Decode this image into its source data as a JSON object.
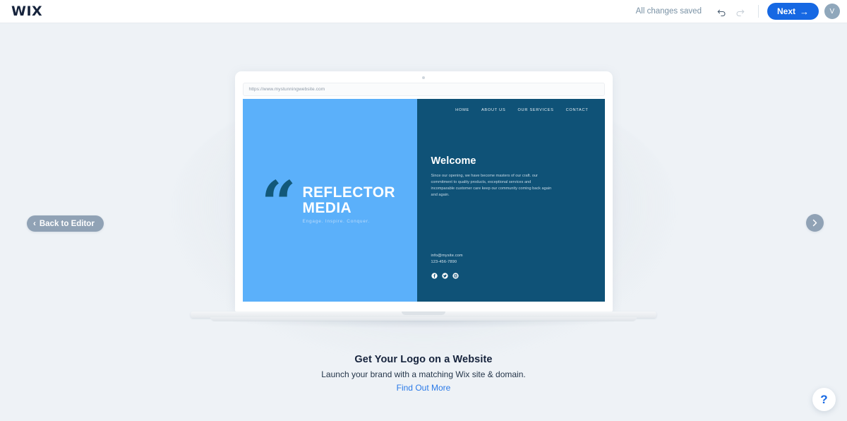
{
  "header": {
    "logo": "WIX",
    "status_text": "All changes saved",
    "undo_icon": "undo-arrow-icon",
    "redo_icon": "redo-arrow-icon",
    "next_label": "Next",
    "next_arrow": "→",
    "avatar_initial": "V",
    "accent_color": "#1668e3",
    "avatar_color": "#8fa7bb"
  },
  "controls": {
    "back_label": "Back to Editor",
    "back_chevron": "‹",
    "next_chevron": "›",
    "help_label": "?",
    "control_color": "#90a2b5"
  },
  "preview": {
    "browser_url": "https://www.mystunningwebsite.com",
    "site": {
      "left_bg": "#5bb0fa",
      "right_bg": "#0f5277",
      "quote_glyph": "“",
      "logo_name_line1": "REFLECTOR",
      "logo_name_line2": "MEDIA",
      "logo_tagline": "Engage. Inspire. Conquer.",
      "nav": [
        {
          "label": "HOME"
        },
        {
          "label": "ABOUT US"
        },
        {
          "label": "OUR SERVICES"
        },
        {
          "label": "CONTACT"
        }
      ],
      "welcome_title": "Welcome",
      "welcome_body": "Since our opening, we have become masters of our craft. our commitment to quality products, exceptional services and incomparable customer care keep our community coming back again and again.",
      "contact_email": "info@mysite.com",
      "contact_phone": "123-456-7890",
      "social": [
        {
          "name": "facebook-icon"
        },
        {
          "name": "twitter-icon"
        },
        {
          "name": "instagram-icon"
        }
      ]
    }
  },
  "promo": {
    "title": "Get Your Logo on a Website",
    "subtitle": "Launch your brand with a matching Wix site & domain.",
    "link": "Find Out More",
    "link_color": "#2b7ae8"
  }
}
